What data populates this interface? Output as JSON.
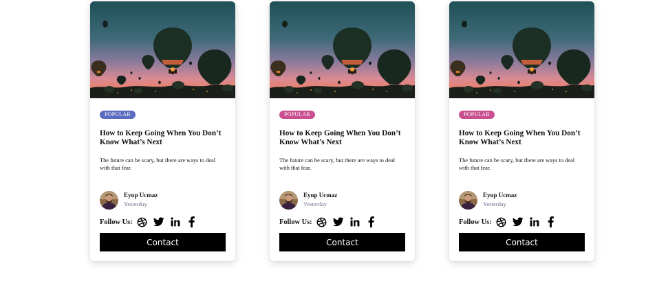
{
  "cards": [
    {
      "badge": "POPULAR",
      "badge_color": "#5b6bbf",
      "title": "How to Keep Going When You Don’t Know What’s Next",
      "description": "The future can be scary, but there are ways to deal with that fear.",
      "author_name": "Eyup Ucmaz",
      "author_time": "Yesterday",
      "follow_label": "Follow Us:",
      "contact_label": "Contact"
    },
    {
      "badge": "POPULAR",
      "badge_color": "#c94f8f",
      "title": "How to Keep Going When You Don’t Know What’s Next",
      "description": "The future can be scary, but there are ways to deal with that fear.",
      "author_name": "Eyup Ucmaz",
      "author_time": "Yesterday",
      "follow_label": "Follow Us:",
      "contact_label": "Contact"
    },
    {
      "badge": "POPULAR",
      "badge_color": "#c94f8f",
      "title": "How to Keep Going When You Don’t Know What’s Next",
      "description": "The future can be scary, but there are ways to deal with that fear.",
      "author_name": "Eyup Ucmaz",
      "author_time": "Yesterday",
      "follow_label": "Follow Us:",
      "contact_label": "Contact"
    }
  ],
  "social_icons": [
    "dribbble-icon",
    "twitter-icon",
    "linkedin-icon",
    "facebook-icon"
  ],
  "colors": {
    "button": "#000000",
    "time_text": "#6a6f8e"
  }
}
